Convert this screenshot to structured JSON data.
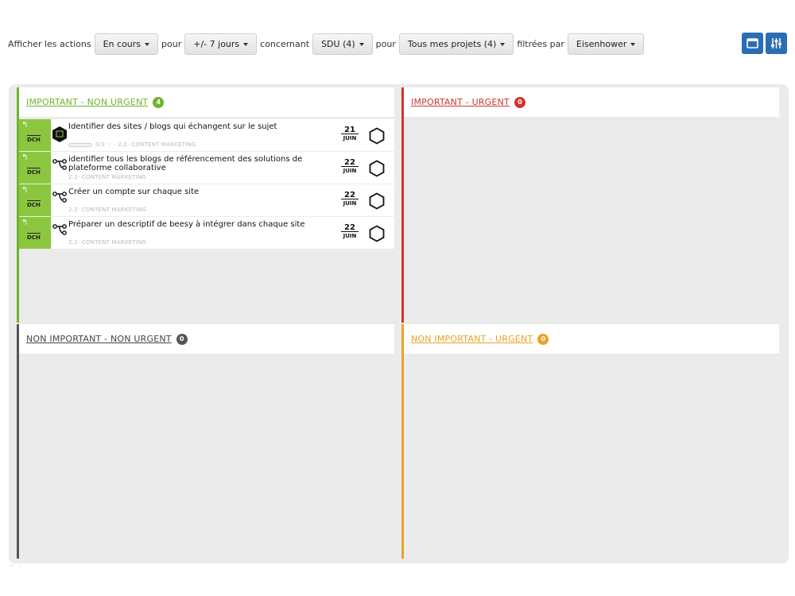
{
  "filters": {
    "label1": "Afficher les actions",
    "status": "En cours",
    "label2": "pour",
    "period": "+/- 7 jours",
    "label3": "concernant",
    "scope": "SDU (4)",
    "label4": "pour",
    "projects": "Tous mes projets (4)",
    "label5": "filtrées par",
    "method": "Eisenhower"
  },
  "toolbar": {
    "window_icon": "window-icon",
    "settings_icon": "sliders-icon"
  },
  "colors": {
    "important_non_urgent": "#6db52c",
    "important_urgent": "#d0362a",
    "non_important_non_urgent": "#555555",
    "non_important_urgent": "#e8a32a",
    "task_side": "#8cc63f",
    "toolbar_button": "#2a6db5"
  },
  "quadrants": [
    {
      "title": "IMPORTANT - NON URGENT",
      "count": "4",
      "tasks": [
        {
          "title": "Identifier des sites / blogs qui échangent sur le sujet",
          "meta": "0/3 ☜ - 2.2- CONTENT MARKETING",
          "day": "21",
          "month": "JUIN",
          "owner": "DCH",
          "icon": "hexagon-box-icon"
        },
        {
          "title": "identifier tous les blogs de référencement des solutions de plateforme collaborative",
          "meta": "2.2- CONTENT MARKETING",
          "day": "22",
          "month": "JUIN",
          "owner": "DCH",
          "icon": "branch-icon"
        },
        {
          "title": "Créer un compte sur chaque site",
          "meta": "2.2- CONTENT MARKETING",
          "day": "22",
          "month": "JUIN",
          "owner": "DCH",
          "icon": "branch-icon"
        },
        {
          "title": "Préparer un descriptif de beesy à intégrer dans chaque site",
          "meta": "2.2- CONTENT MARKETING",
          "day": "22",
          "month": "JUIN",
          "owner": "DCH",
          "icon": "branch-icon"
        }
      ]
    },
    {
      "title": "IMPORTANT - URGENT",
      "count": "0",
      "tasks": []
    },
    {
      "title": "NON IMPORTANT - NON URGENT",
      "count": "0",
      "tasks": []
    },
    {
      "title": "NON IMPORTANT - URGENT",
      "count": "0",
      "tasks": []
    }
  ]
}
